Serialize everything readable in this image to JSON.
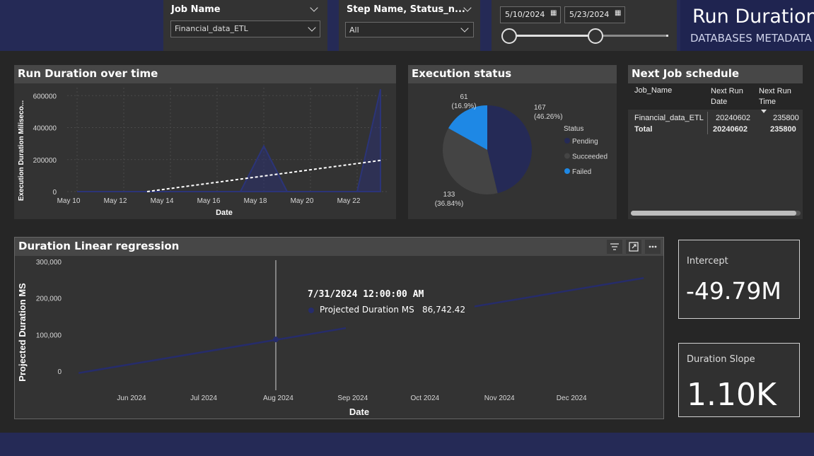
{
  "header": {
    "title": "Run Duration",
    "subtitle": "DATABASES METADATA",
    "job_slicer": {
      "title": "Job Name",
      "value": "Financial_data_ETL"
    },
    "step_slicer": {
      "title": "Step Name, Status_n...",
      "value": "All"
    },
    "date_slicer": {
      "start": "5/10/2024",
      "end": "5/23/2024"
    }
  },
  "run_duration_chart": {
    "title": "Run Duration over time",
    "chart_data": {
      "type": "area",
      "title": "Run Duration over time",
      "xlabel": "Date",
      "ylabel": "Execution Duration Miliseco...",
      "x_ticks": [
        "May 10",
        "May 12",
        "May 14",
        "May 16",
        "May 18",
        "May 20",
        "May 22"
      ],
      "y_ticks": [
        "0",
        "200000",
        "400000",
        "600000"
      ],
      "ylim": [
        0,
        650000
      ],
      "series": [
        {
          "values": [
            {
              "x": "2024-05-10",
              "y": 0
            },
            {
              "x": "2024-05-12",
              "y": 0
            },
            {
              "x": "2024-05-14",
              "y": 0
            },
            {
              "x": "2024-05-16",
              "y": 0
            },
            {
              "x": "2024-05-17",
              "y": 0
            },
            {
              "x": "2024-05-18",
              "y": 285000
            },
            {
              "x": "2024-05-19",
              "y": 0
            },
            {
              "x": "2024-05-22",
              "y": 0
            },
            {
              "x": "2024-05-23",
              "y": 640000
            }
          ]
        }
      ],
      "trend_line": [
        {
          "x": "2024-05-13",
          "y": 0
        },
        {
          "x": "2024-05-23",
          "y": 195000
        }
      ]
    }
  },
  "execution_status": {
    "title": "Execution status",
    "legend_title": "Status",
    "chart_data": {
      "type": "pie",
      "title": "Execution status",
      "legend_placement": "right",
      "slices": [
        {
          "label": "Pending",
          "value": 167,
          "percent": "(46.26%)",
          "color": "#252a56"
        },
        {
          "label": "Succeeded",
          "value": 133,
          "percent": "(36.84%)",
          "color": "#444444"
        },
        {
          "label": "Failed",
          "value": 61,
          "percent": "(16.9%)",
          "color": "#1e88e5"
        }
      ]
    }
  },
  "next_job": {
    "title": "Next Job schedule",
    "columns": [
      "Job_Name",
      "Next Run Date",
      "Next Run Time"
    ],
    "rows": [
      [
        "Financial_data_ETL",
        "20240602",
        "235800"
      ]
    ],
    "total": [
      "Total",
      "20240602",
      "235800"
    ]
  },
  "regression_chart": {
    "title": "Duration Linear regression",
    "chart_data": {
      "type": "line",
      "title": "Duration Linear regression",
      "xlabel": "Date",
      "ylabel": "Projected Duration MS",
      "x_ticks": [
        "Jun 2024",
        "Jul 2024",
        "Aug 2024",
        "Sep 2024",
        "Oct 2024",
        "Nov 2024",
        "Dec 2024"
      ],
      "y_ticks": [
        "0",
        "100,000",
        "200,000",
        "300,000"
      ],
      "ylim": [
        -20000,
        300000
      ],
      "series": [
        {
          "name": "Projected Duration MS",
          "values": [
            {
              "x": "2024-05-10",
              "y": -5000
            },
            {
              "x": "2024-12-31",
              "y": 255000
            }
          ]
        }
      ]
    },
    "tooltip": {
      "date": "7/31/2024 12:00:00 AM",
      "series": "Projected Duration MS",
      "value": "86,742.42"
    }
  },
  "cards": {
    "intercept": {
      "label": "Intercept",
      "value": "-49.79M"
    },
    "slope": {
      "label": "Duration Slope",
      "value": "1.10K"
    }
  }
}
